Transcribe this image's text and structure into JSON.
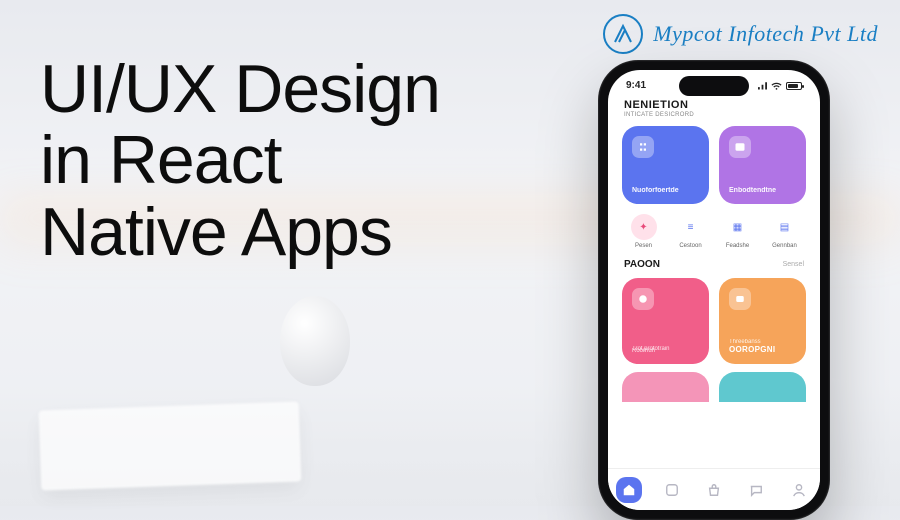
{
  "brand": {
    "name": "Mypcot Infotech Pvt Ltd"
  },
  "headline": {
    "line1": "UI/UX Design",
    "line2": "in React",
    "line3": "Native Apps"
  },
  "phone": {
    "status": {
      "time": "9:41"
    },
    "section1": {
      "title": "NENIETION",
      "subtitle": "INTICATE DESICRORD"
    },
    "tiles1": [
      {
        "label": "Nuoforfoertde",
        "color": "blue"
      },
      {
        "label": "Enbodtendtne",
        "color": "purple"
      }
    ],
    "quick": [
      {
        "label": "Pesen"
      },
      {
        "label": "Cestoon"
      },
      {
        "label": "Feadshe"
      },
      {
        "label": "Gennban"
      }
    ],
    "section2": {
      "title": "PAOON",
      "more": "Sensel"
    },
    "tiles2": [
      {
        "sub": "Trot profotrain",
        "sub2": "Roorhuh",
        "color": "pink"
      },
      {
        "sub": "Threebanss",
        "big": "OOROPGNI",
        "color": "orange"
      }
    ]
  }
}
